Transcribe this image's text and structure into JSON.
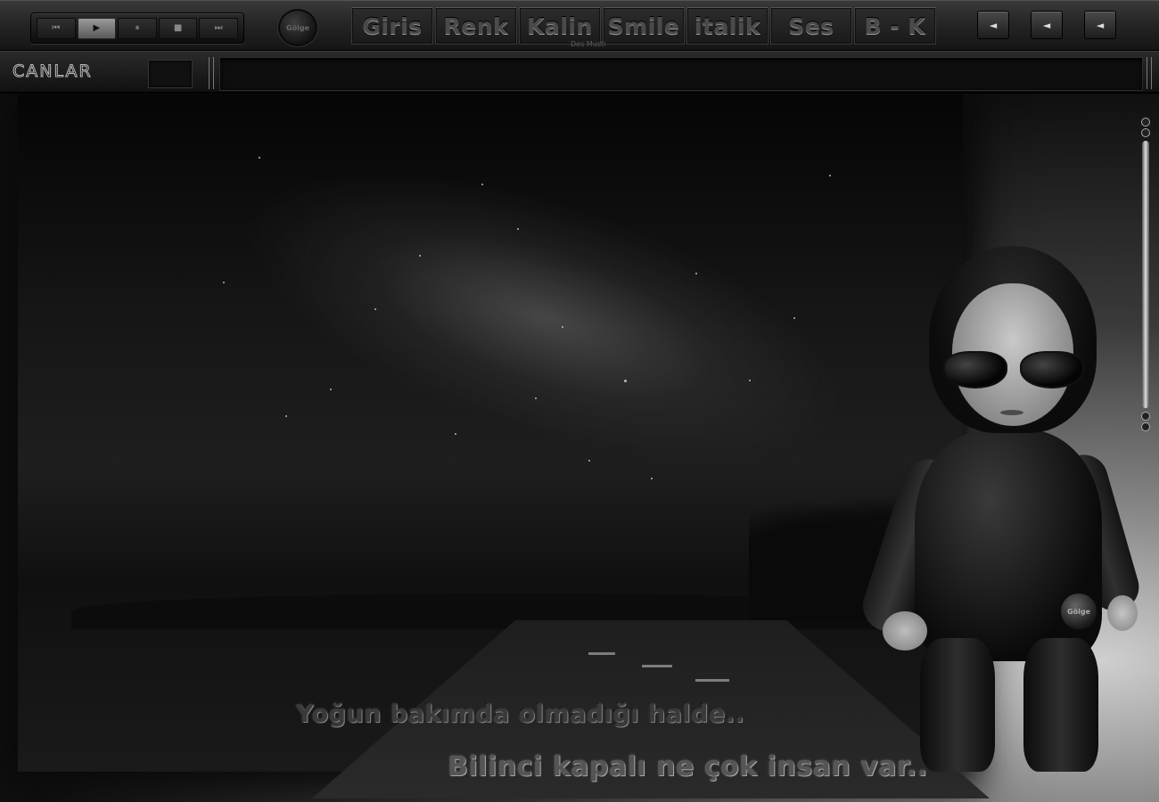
{
  "toolbar": {
    "player": {
      "prev_icon": "⏮",
      "play_icon": "▶",
      "pause_icon": "⏸",
      "stop_icon": "■",
      "next_icon": "⏭"
    },
    "logo_text": "Gölge",
    "tabs": [
      {
        "label": "Giris"
      },
      {
        "label": "Renk"
      },
      {
        "label": "Kalin"
      },
      {
        "label": "Smile"
      },
      {
        "label": "italik"
      },
      {
        "label": "Ses"
      },
      {
        "label": "B - K"
      }
    ],
    "subcaption": "Des Musti",
    "arrow_buttons": [
      {
        "icon": "◄"
      },
      {
        "icon": "◄"
      },
      {
        "icon": "◄"
      }
    ]
  },
  "chatbar": {
    "brand": "CANLAR",
    "message_value": ""
  },
  "content": {
    "caption_line1": "Yoğun bakımda olmadığı halde..",
    "caption_line2": "Bilinci kapalı ne çok insan var..",
    "badge_text": "Gölge"
  }
}
